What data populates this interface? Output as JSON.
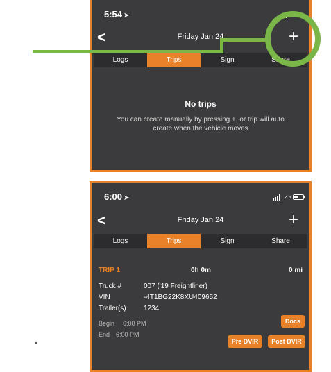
{
  "top_screen": {
    "status_time": "5:54",
    "nav": {
      "back_label": "<",
      "title": "Friday Jan 24",
      "add_label": "+"
    },
    "tabs": [
      {
        "label": "Logs",
        "active": false
      },
      {
        "label": "Trips",
        "active": true
      },
      {
        "label": "Sign",
        "active": false
      },
      {
        "label": "Share",
        "active": false
      }
    ],
    "empty": {
      "title": "No trips",
      "message": "You can create manually by pressing +, or trip will auto create when the vehicle moves"
    }
  },
  "bottom_screen": {
    "status_time": "6:00",
    "nav": {
      "back_label": "<",
      "title": "Friday Jan 24",
      "add_label": "+"
    },
    "tabs": [
      {
        "label": "Logs",
        "active": false
      },
      {
        "label": "Trips",
        "active": true
      },
      {
        "label": "Sign",
        "active": false
      },
      {
        "label": "Share",
        "active": false
      }
    ],
    "trip": {
      "name": "TRIP 1",
      "duration": "0h 0m",
      "distance": "0 mi",
      "truck_label": "Truck #",
      "truck_value": "007 ('19 Freightliner)",
      "vin_label": "VIN",
      "vin_value": "-4T1BG22K8XU409652",
      "trailer_label": "Trailer(s)",
      "trailer_value": "1234",
      "begin_label": "Begin",
      "begin_value": "6:00 PM",
      "end_label": "End",
      "end_value": "6:00 PM"
    },
    "buttons": {
      "docs": "Docs",
      "pre_dvir": "Pre DVIR",
      "post_dvir": "Post DVIR"
    }
  },
  "colors": {
    "accent": "#e8822a",
    "callout": "#7ab648",
    "background": "#3b3b3d"
  }
}
